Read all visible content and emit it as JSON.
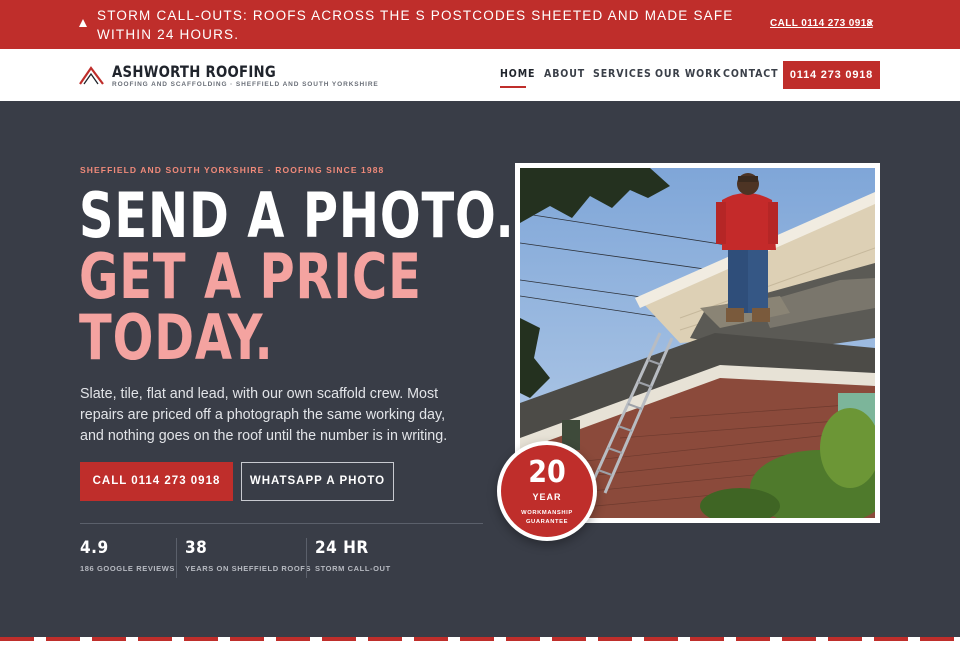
{
  "alert": {
    "text": "STORM CALL-OUTS: ROOFS ACROSS THE S POSTCODES SHEETED AND MADE SAFE WITHIN 24 HOURS.",
    "link_label": "CALL 0114 273 0918",
    "close_label": "×",
    "icon": "warning-triangle-icon"
  },
  "header": {
    "brand_name": "ASHWORTH ROOFING",
    "brand_tagline": "ROOFING AND SCAFFOLDING · SHEFFIELD AND SOUTH YORKSHIRE",
    "nav": [
      "HOME",
      "ABOUT",
      "SERVICES",
      "OUR WORK",
      "CONTACT"
    ],
    "active_nav": "HOME",
    "phone_button": "0114 273 0918"
  },
  "hero": {
    "kicker": "SHEFFIELD AND SOUTH YORKSHIRE · ROOFING SINCE 1988",
    "headline_line1": "SEND A PHOTO.",
    "headline_line2": "GET A PRICE",
    "headline_line3": "TODAY.",
    "lede": "Slate, tile, flat and lead, with our own scaffold crew. Most repairs are priced off a photograph the same working day, and nothing goes on the roof until the number is in writing.",
    "primary_button": "CALL 0114 273 0918",
    "secondary_button": "WHATSAPP A PHOTO",
    "stats": [
      {
        "value": "4.9",
        "label": "186 GOOGLE REVIEWS"
      },
      {
        "value": "38",
        "label": "YEARS ON SHEFFIELD ROOFS"
      },
      {
        "value": "24 HR",
        "label": "STORM CALL-OUT"
      }
    ],
    "badge": {
      "number": "20",
      "unit": "YEAR",
      "caption": "WORKMANSHIP GUARANTEE"
    }
  },
  "colors": {
    "brand_red": "#bf2e2b",
    "hero_bg": "#393d47",
    "accent_pink": "#f4a3a0"
  }
}
